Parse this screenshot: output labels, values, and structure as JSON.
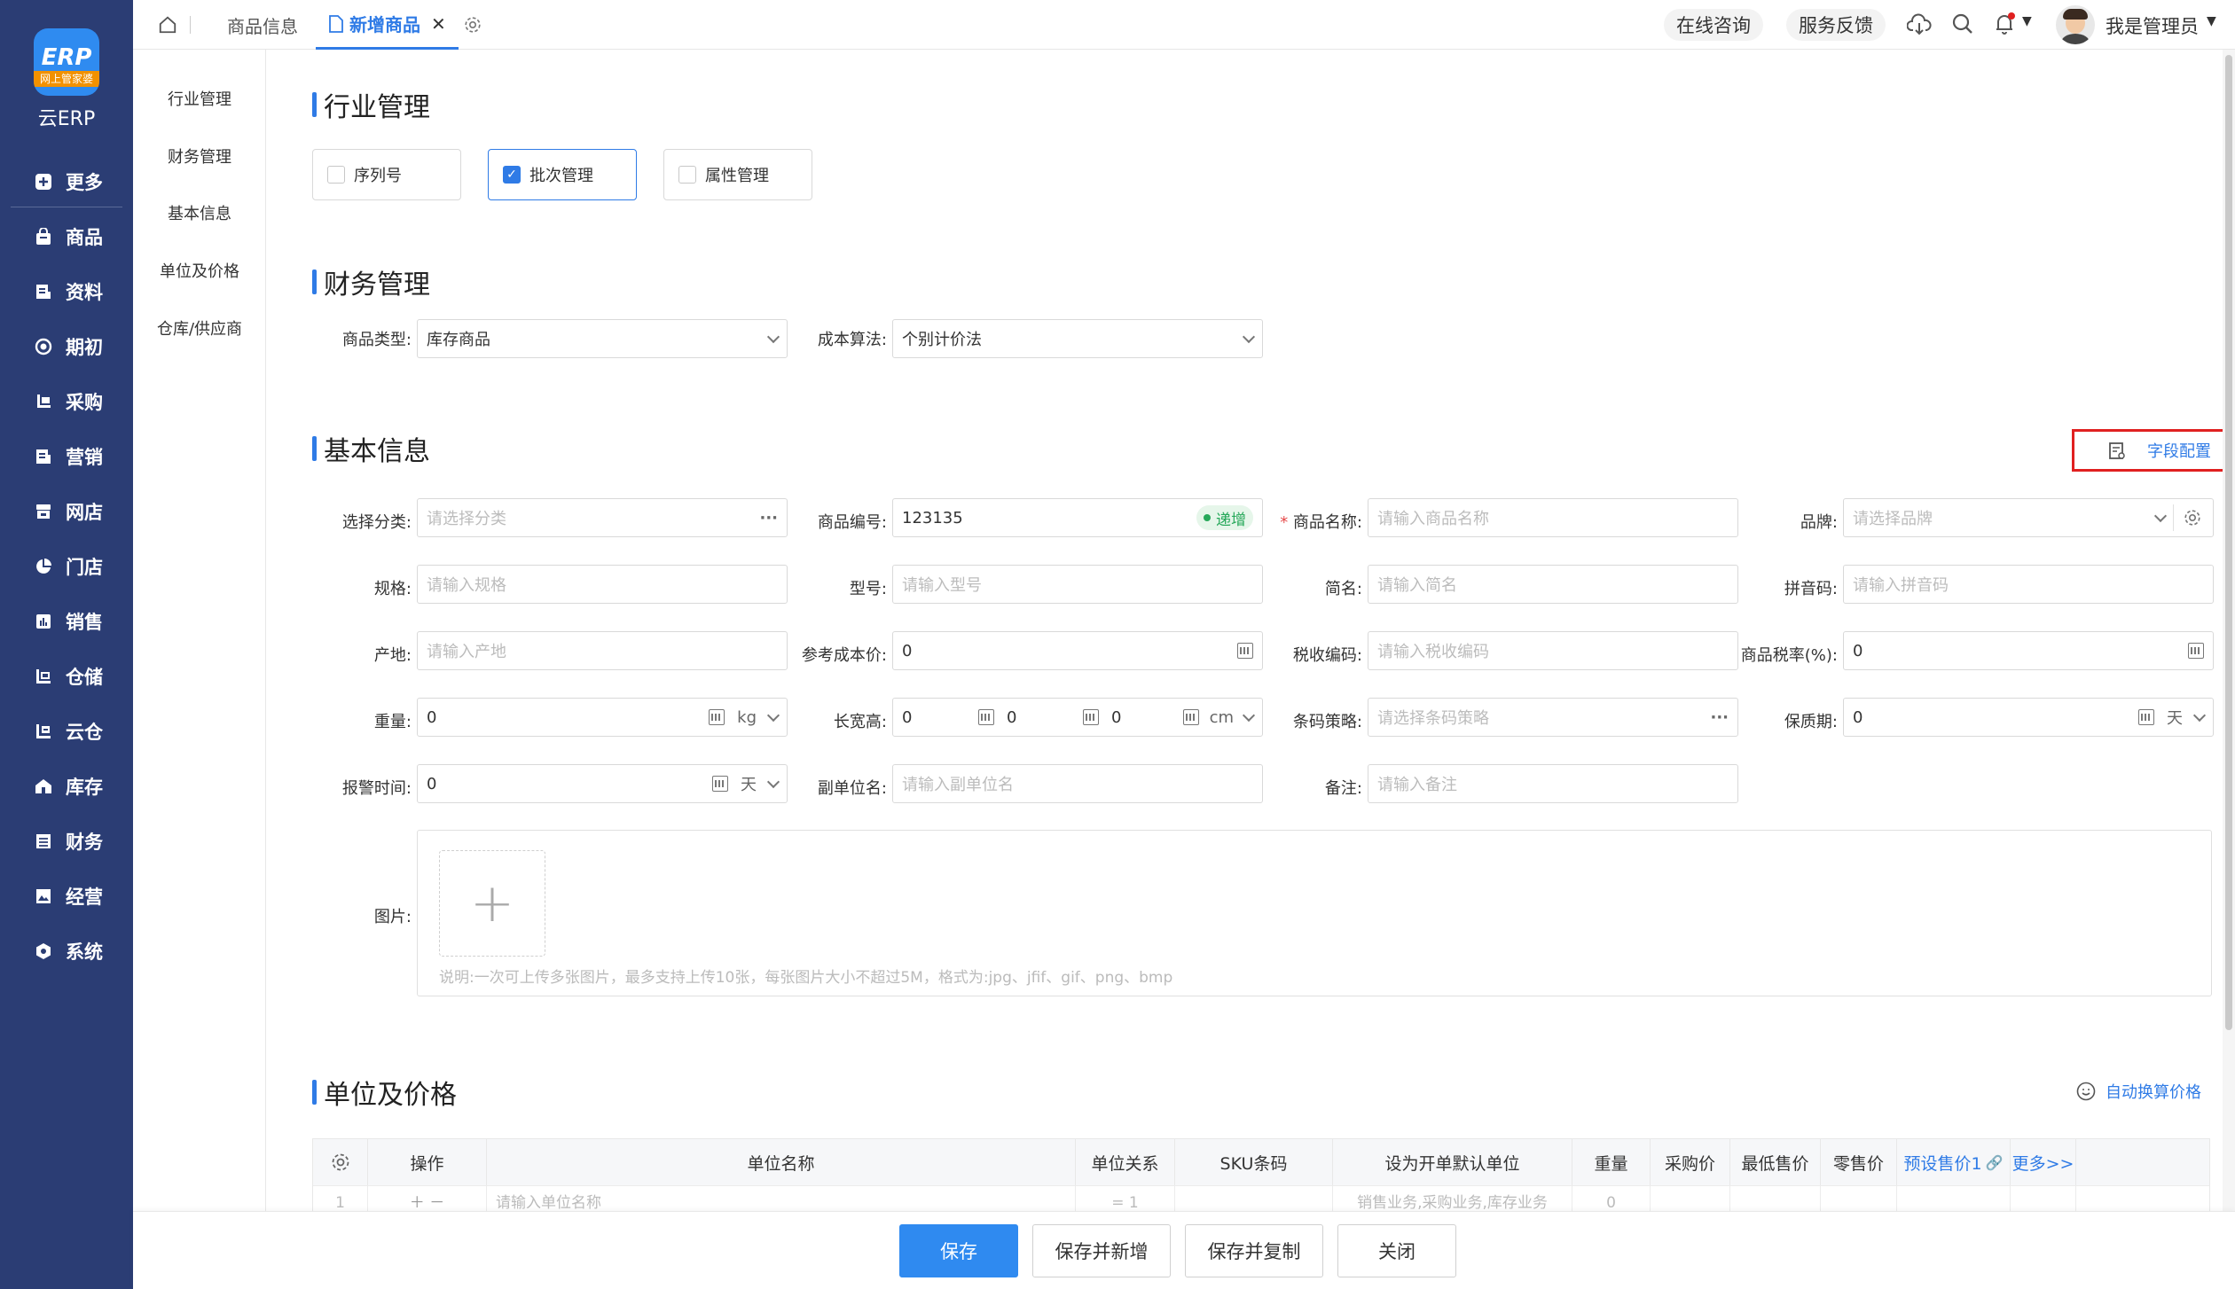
{
  "app": {
    "logo_band": "网上管家婆",
    "logo_text": "云ERP",
    "logo_mark": "ERP"
  },
  "leftnav": [
    {
      "label": "更多",
      "icon": "plus-square-icon"
    },
    {
      "label": "商品",
      "icon": "bag-icon"
    },
    {
      "label": "资料",
      "icon": "document-icon"
    },
    {
      "label": "期初",
      "icon": "target-icon"
    },
    {
      "label": "采购",
      "icon": "cart-icon"
    },
    {
      "label": "营销",
      "icon": "megaphone-icon"
    },
    {
      "label": "网店",
      "icon": "shop-icon"
    },
    {
      "label": "门店",
      "icon": "pie-icon"
    },
    {
      "label": "销售",
      "icon": "bar-chart-icon"
    },
    {
      "label": "仓储",
      "icon": "warehouse-icon"
    },
    {
      "label": "云仓",
      "icon": "cloud-warehouse-icon"
    },
    {
      "label": "库存",
      "icon": "house-icon"
    },
    {
      "label": "财务",
      "icon": "finance-icon"
    },
    {
      "label": "经营",
      "icon": "image-icon"
    },
    {
      "label": "系统",
      "icon": "hexagon-icon"
    }
  ],
  "topbar": {
    "tabs": [
      {
        "label": "商品信息"
      },
      {
        "label": "新增商品"
      }
    ],
    "consult": "在线咨询",
    "feedback": "服务反馈",
    "user": "我是管理员"
  },
  "subnav": [
    "行业管理",
    "财务管理",
    "基本信息",
    "单位及价格",
    "仓库/供应商"
  ],
  "sections": {
    "industry": "行业管理",
    "finance": "财务管理",
    "basic": "基本信息",
    "unit": "单位及价格"
  },
  "industry_options": [
    {
      "label": "序列号",
      "checked": false
    },
    {
      "label": "批次管理",
      "checked": true
    },
    {
      "label": "属性管理",
      "checked": false
    }
  ],
  "finance": {
    "type_label": "商品类型:",
    "type_value": "库存商品",
    "cost_label": "成本算法:",
    "cost_value": "个别计价法"
  },
  "field_config": "字段配置",
  "basic": {
    "category": {
      "label": "选择分类:",
      "placeholder": "请选择分类"
    },
    "code": {
      "label": "商品编号:",
      "value": "123135",
      "badge": "递增"
    },
    "name": {
      "label": "商品名称:",
      "placeholder": "请输入商品名称"
    },
    "brand": {
      "label": "品牌:",
      "placeholder": "请选择品牌"
    },
    "spec": {
      "label": "规格:",
      "placeholder": "请输入规格"
    },
    "model": {
      "label": "型号:",
      "placeholder": "请输入型号"
    },
    "short": {
      "label": "简名:",
      "placeholder": "请输入简名"
    },
    "pinyin": {
      "label": "拼音码:",
      "placeholder": "请输入拼音码"
    },
    "origin": {
      "label": "产地:",
      "placeholder": "请输入产地"
    },
    "refcost": {
      "label": "参考成本价:",
      "value": "0"
    },
    "taxcode": {
      "label": "税收编码:",
      "placeholder": "请输入税收编码"
    },
    "taxrate": {
      "label": "商品税率(%):",
      "value": "0"
    },
    "weight": {
      "label": "重量:",
      "value": "0",
      "unit": "kg"
    },
    "lwh": {
      "label": "长宽高:",
      "l": "0",
      "w": "0",
      "h": "0",
      "unit": "cm"
    },
    "barcode": {
      "label": "条码策略:",
      "placeholder": "请选择条码策略"
    },
    "shelf": {
      "label": "保质期:",
      "value": "0",
      "unit": "天"
    },
    "alarm": {
      "label": "报警时间:",
      "value": "0",
      "unit": "天"
    },
    "subunit": {
      "label": "副单位名:",
      "placeholder": "请输入副单位名"
    },
    "remark": {
      "label": "备注:",
      "placeholder": "请输入备注"
    },
    "image": {
      "label": "图片:",
      "tip": "说明:一次可上传多张图片，最多支持上传10张，每张图片大小不超过5M，格式为:jpg、jfif、gif、png、bmp"
    }
  },
  "unit_section": {
    "auto_price": "自动换算价格",
    "headers": [
      "操作",
      "单位名称",
      "单位关系",
      "SKU条码",
      "设为开单默认单位",
      "重量",
      "采购价",
      "最低售价",
      "零售价",
      "预设售价1",
      "更多>>"
    ],
    "row": {
      "index": "1",
      "name_placeholder": "请输入单位名称",
      "relation": "= 1",
      "default_unit": "销售业务,采购业务,库存业务",
      "weight": "0"
    }
  },
  "footer": {
    "save": "保存",
    "save_new": "保存并新增",
    "save_copy": "保存并复制",
    "close": "关闭"
  },
  "colors": {
    "nav_bg": "#2b3d74",
    "accent": "#2f7be6",
    "primary_btn": "#2f8af0",
    "highlight_box": "#e02020",
    "required": "#e64b4b"
  }
}
